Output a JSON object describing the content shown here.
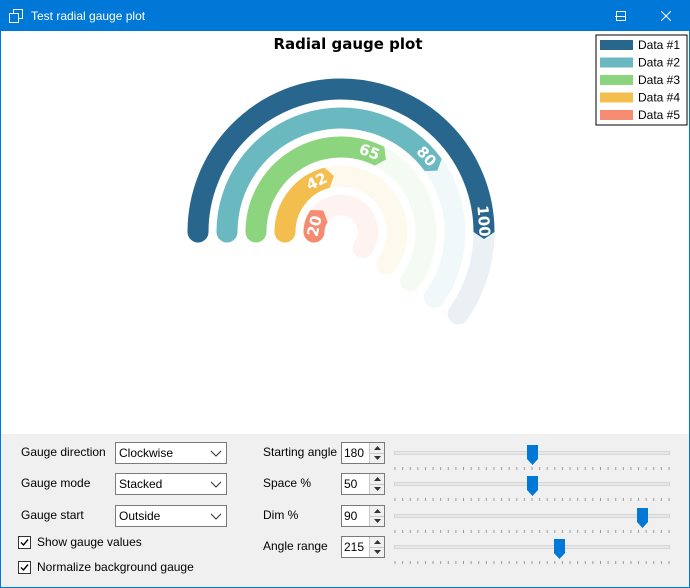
{
  "window": {
    "title": "Test radial gauge plot"
  },
  "chart_data": {
    "type": "radial-gauge",
    "title": "Radial gauge plot",
    "series": [
      {
        "name": "Data #1",
        "value": 100,
        "color": "#28668e"
      },
      {
        "name": "Data #2",
        "value": 80,
        "color": "#6ab9c1"
      },
      {
        "name": "Data #3",
        "value": 65,
        "color": "#8dd47e"
      },
      {
        "name": "Data #4",
        "value": 42,
        "color": "#f4be4f"
      },
      {
        "name": "Data #5",
        "value": 20,
        "color": "#f58b70"
      }
    ],
    "max": 100,
    "direction": "Clockwise",
    "mode": "Stacked",
    "start": "Outside",
    "starting_angle_deg": 180,
    "angle_range_deg": 215,
    "show_values": true,
    "legend_position": "top-right"
  },
  "controls": {
    "direction": {
      "label": "Gauge direction",
      "value": "Clockwise"
    },
    "mode": {
      "label": "Gauge mode",
      "value": "Stacked"
    },
    "start": {
      "label": "Gauge start",
      "value": "Outside"
    },
    "show_values": {
      "label": "Show gauge values",
      "checked": true
    },
    "normalize": {
      "label": "Normalize background gauge",
      "checked": true
    },
    "starting_angle": {
      "label": "Starting angle",
      "value": "180",
      "min": 0,
      "max": 360,
      "position": 0.5
    },
    "space": {
      "label": "Space %",
      "value": "50",
      "min": 0,
      "max": 100,
      "position": 0.5
    },
    "dim": {
      "label": "Dim %",
      "value": "90",
      "min": 0,
      "max": 100,
      "position": 0.9
    },
    "angle_range": {
      "label": "Angle range",
      "value": "215",
      "min": 0,
      "max": 360,
      "position": 0.6
    }
  }
}
